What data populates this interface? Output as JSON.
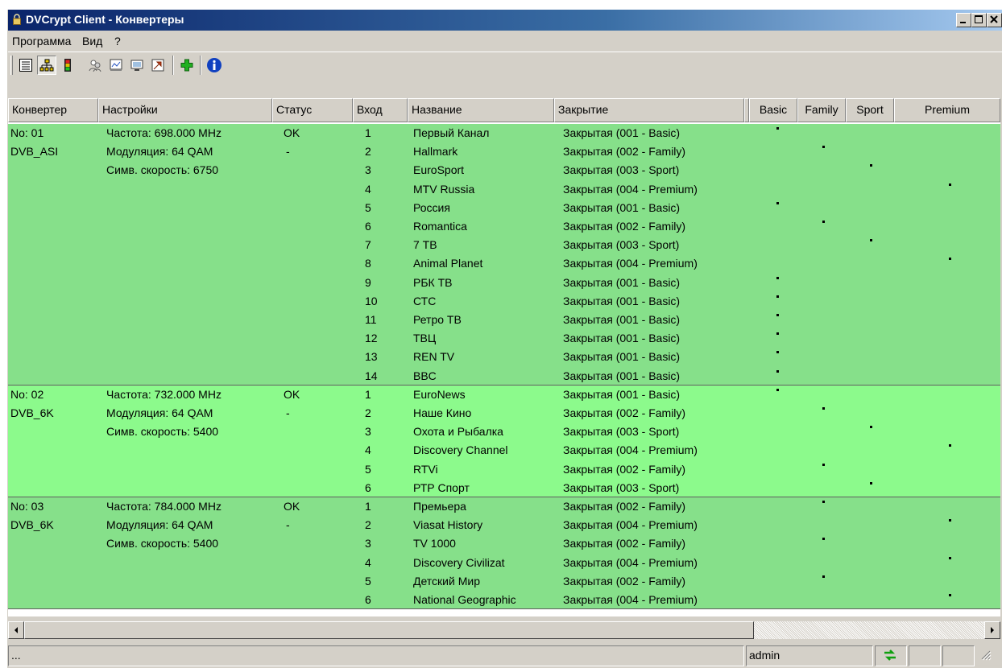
{
  "window": {
    "title": "DVCrypt Client - Конвертеры"
  },
  "menu": [
    {
      "label": "Программа"
    },
    {
      "label": "Вид"
    },
    {
      "label": "?"
    }
  ],
  "toolbar": {
    "icons": [
      "list-view-icon",
      "tree-view-icon",
      "traffic-light-icon",
      "users-icon",
      "packages-icon",
      "cards-icon",
      "tools-icon",
      "add-icon",
      "info-icon"
    ]
  },
  "columns": [
    "Конвертер",
    "Настройки",
    "Статус",
    "Вход",
    "Название",
    "Закрытие",
    "",
    "Basic",
    "Family",
    "Sport",
    "Premium"
  ],
  "colors": {
    "rowA": "#86e08a",
    "rowB": "#8cfa8c",
    "titleStart": "#0a246a",
    "titleEnd": "#a6caf0"
  },
  "converters": [
    {
      "no": "No: 01",
      "type": "DVB_ASI",
      "settings": [
        "Частота: 698.000 MHz",
        "Модуляция: 64 QAM",
        "Симв. скорость: 6750"
      ],
      "status": "OK",
      "status2": "-",
      "channels": [
        {
          "input": "1",
          "name": "Первый Канал",
          "closing": "Закрытая (001 - Basic)",
          "pkg": 0
        },
        {
          "input": "2",
          "name": "Hallmark",
          "closing": "Закрытая (002 - Family)",
          "pkg": 1
        },
        {
          "input": "3",
          "name": "EuroSport",
          "closing": "Закрытая (003 - Sport)",
          "pkg": 2
        },
        {
          "input": "4",
          "name": "MTV Russia",
          "closing": "Закрытая (004 - Premium)",
          "pkg": 3
        },
        {
          "input": "5",
          "name": "Россия",
          "closing": "Закрытая (001 - Basic)",
          "pkg": 0
        },
        {
          "input": "6",
          "name": "Romantica",
          "closing": "Закрытая (002 - Family)",
          "pkg": 1
        },
        {
          "input": "7",
          "name": "7 ТВ",
          "closing": "Закрытая (003 - Sport)",
          "pkg": 2
        },
        {
          "input": "8",
          "name": "Animal Planet",
          "closing": "Закрытая (004 - Premium)",
          "pkg": 3
        },
        {
          "input": "9",
          "name": "РБК ТВ",
          "closing": "Закрытая (001 - Basic)",
          "pkg": 0
        },
        {
          "input": "10",
          "name": "СТС",
          "closing": "Закрытая (001 - Basic)",
          "pkg": 0
        },
        {
          "input": "11",
          "name": "Ретро ТВ",
          "closing": "Закрытая (001 - Basic)",
          "pkg": 0
        },
        {
          "input": "12",
          "name": "ТВЦ",
          "closing": "Закрытая (001 - Basic)",
          "pkg": 0
        },
        {
          "input": "13",
          "name": "REN TV",
          "closing": "Закрытая (001 - Basic)",
          "pkg": 0
        },
        {
          "input": "14",
          "name": "BBC",
          "closing": "Закрытая (001 - Basic)",
          "pkg": 0
        }
      ]
    },
    {
      "no": "No: 02",
      "type": "DVB_6K",
      "settings": [
        "Частота: 732.000 MHz",
        "Модуляция: 64 QAM",
        "Симв. скорость: 5400"
      ],
      "status": "OK",
      "status2": "-",
      "channels": [
        {
          "input": "1",
          "name": "EuroNews",
          "closing": "Закрытая (001 - Basic)",
          "pkg": 0
        },
        {
          "input": "2",
          "name": "Наше Кино",
          "closing": "Закрытая (002 - Family)",
          "pkg": 1
        },
        {
          "input": "3",
          "name": "Охота и Рыбалка",
          "closing": "Закрытая (003 - Sport)",
          "pkg": 2
        },
        {
          "input": "4",
          "name": "Discovery Channel",
          "closing": "Закрытая (004 - Premium)",
          "pkg": 3
        },
        {
          "input": "5",
          "name": "RTVi",
          "closing": "Закрытая (002 - Family)",
          "pkg": 1
        },
        {
          "input": "6",
          "name": "РТР Спорт",
          "closing": "Закрытая (003 - Sport)",
          "pkg": 2
        }
      ]
    },
    {
      "no": "No: 03",
      "type": "DVB_6K",
      "settings": [
        "Частота: 784.000 MHz",
        "Модуляция: 64 QAM",
        "Симв. скорость: 5400"
      ],
      "status": "OK",
      "status2": "-",
      "channels": [
        {
          "input": "1",
          "name": "Премьера",
          "closing": "Закрытая (002 - Family)",
          "pkg": 1
        },
        {
          "input": "2",
          "name": "Viasat History",
          "closing": "Закрытая (004 - Premium)",
          "pkg": 3
        },
        {
          "input": "3",
          "name": "TV 1000",
          "closing": "Закрытая (002 - Family)",
          "pkg": 1
        },
        {
          "input": "4",
          "name": "Discovery Civilizat",
          "closing": "Закрытая (004 - Premium)",
          "pkg": 3
        },
        {
          "input": "5",
          "name": "Детский Мир",
          "closing": "Закрытая (002 - Family)",
          "pkg": 1
        },
        {
          "input": "6",
          "name": "National Geographic",
          "closing": "Закрытая (004 - Premium)",
          "pkg": 3
        }
      ]
    }
  ],
  "statusbar": {
    "left": "...",
    "user": "admin",
    "connection_icon": "connection-icon"
  }
}
